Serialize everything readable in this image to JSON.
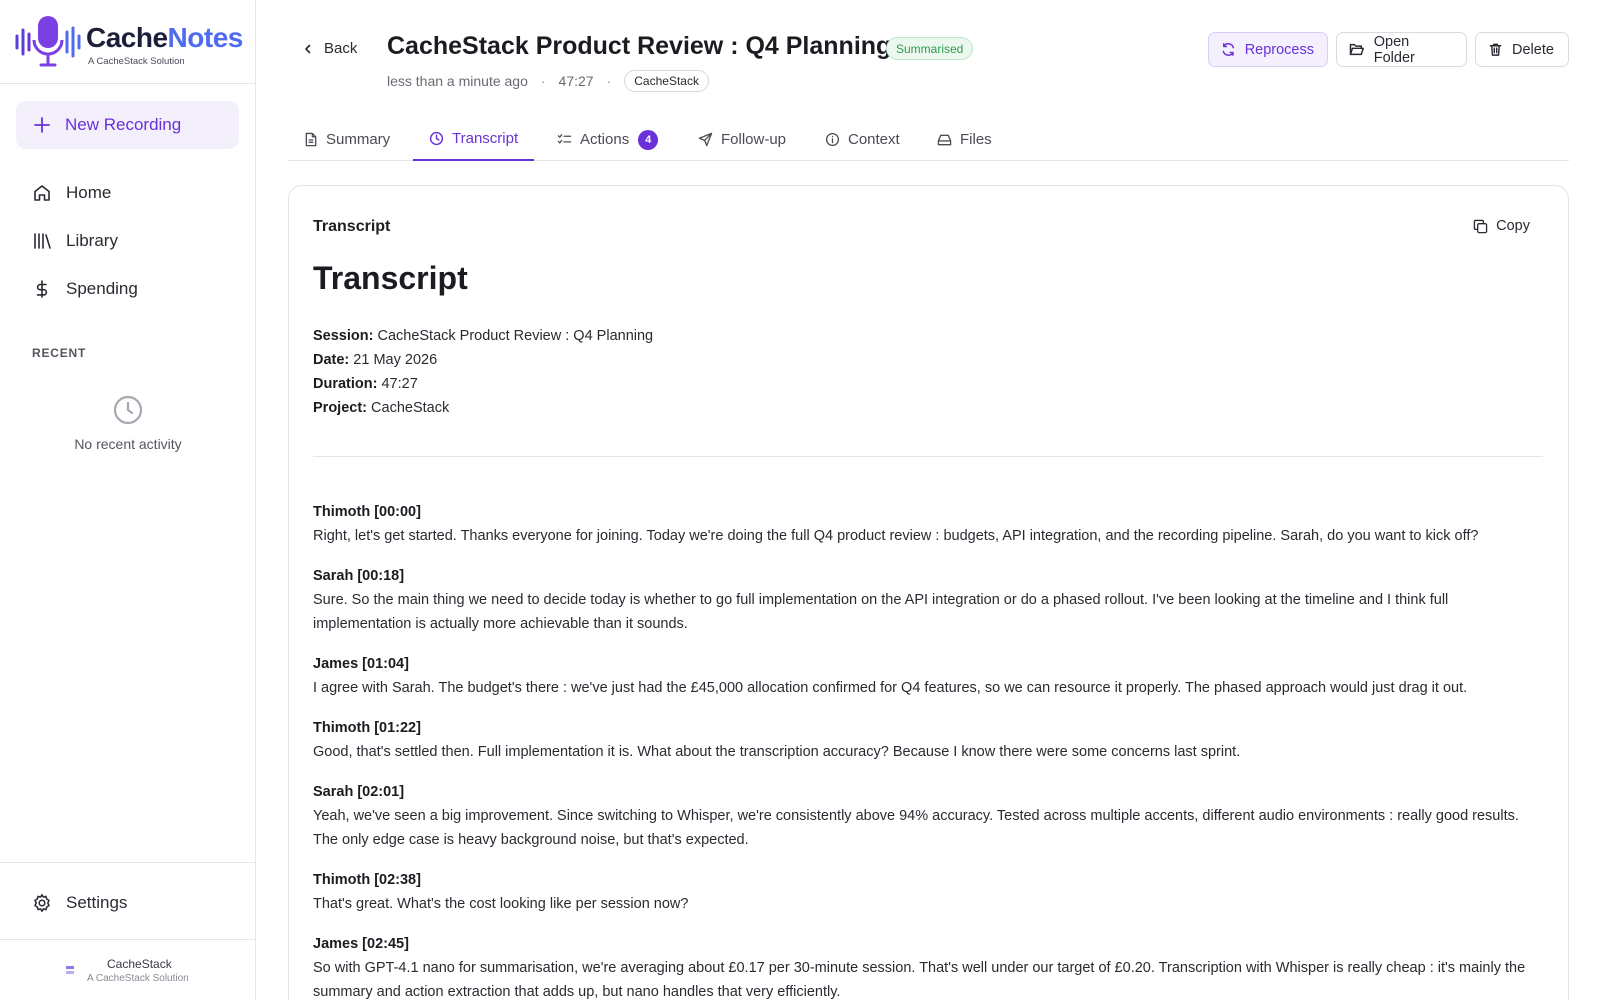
{
  "app": {
    "brand_part1": "Cache",
    "brand_part2": "Notes",
    "tagline": "A CacheStack Solution",
    "footer_name": "CacheStack",
    "footer_tagline": "A CacheStack Solution"
  },
  "sidebar": {
    "new_recording": "New Recording",
    "nav": [
      {
        "label": "Home",
        "icon": "home-icon"
      },
      {
        "label": "Library",
        "icon": "library-icon"
      },
      {
        "label": "Spending",
        "icon": "dollar-icon"
      }
    ],
    "recent_label": "RECENT",
    "no_recent": "No recent activity",
    "settings": "Settings"
  },
  "header": {
    "back": "Back",
    "title": "CacheStack Product Review : Q4 Planning",
    "status": "Summarised",
    "time_ago": "less than a minute ago",
    "duration": "47:27",
    "project": "CacheStack",
    "reprocess": "Reprocess",
    "open_folder": "Open Folder",
    "delete": "Delete"
  },
  "tabs": [
    {
      "label": "Summary",
      "icon": "document-icon"
    },
    {
      "label": "Transcript",
      "icon": "clock-icon",
      "active": true
    },
    {
      "label": "Actions",
      "icon": "checklist-icon",
      "count": "4"
    },
    {
      "label": "Follow-up",
      "icon": "send-icon"
    },
    {
      "label": "Context",
      "icon": "info-icon"
    },
    {
      "label": "Files",
      "icon": "drive-icon"
    }
  ],
  "transcript": {
    "card_title": "Transcript",
    "copy": "Copy",
    "heading": "Transcript",
    "info": {
      "session_label": "Session:",
      "session": "CacheStack Product Review : Q4 Planning",
      "date_label": "Date:",
      "date": "21 May 2026",
      "duration_label": "Duration:",
      "duration": "47:27",
      "project_label": "Project:",
      "project": "CacheStack"
    },
    "entries": [
      {
        "speaker": "Thimoth [00:00]",
        "text": "Right, let's get started. Thanks everyone for joining. Today we're doing the full Q4 product review : budgets, API integration, and the recording pipeline. Sarah, do you want to kick off?"
      },
      {
        "speaker": "Sarah [00:18]",
        "text": "Sure. So the main thing we need to decide today is whether to go full implementation on the API integration or do a phased rollout. I've been looking at the timeline and I think full implementation is actually more achievable than it sounds."
      },
      {
        "speaker": "James [01:04]",
        "text": "I agree with Sarah. The budget's there : we've just had the £45,000 allocation confirmed for Q4 features, so we can resource it properly. The phased approach would just drag it out."
      },
      {
        "speaker": "Thimoth [01:22]",
        "text": "Good, that's settled then. Full implementation it is. What about the transcription accuracy? Because I know there were some concerns last sprint."
      },
      {
        "speaker": "Sarah [02:01]",
        "text": "Yeah, we've seen a big improvement. Since switching to Whisper, we're consistently above 94% accuracy. Tested across multiple accents, different audio environments : really good results. The only edge case is heavy background noise, but that's expected."
      },
      {
        "speaker": "Thimoth [02:38]",
        "text": "That's great. What's the cost looking like per session now?"
      },
      {
        "speaker": "James [02:45]",
        "text": "So with GPT-4.1 nano for summarisation, we're averaging about £0.17 per 30-minute session. That's well under our target of £0.20. Transcription with Whisper is really cheap : it's mainly the summary and action extraction that adds up, but nano handles that very efficiently."
      }
    ]
  },
  "colors": {
    "accent": "#6a31d8",
    "brand_blue": "#4f6cf0",
    "status_green": "#2f9a4d"
  }
}
